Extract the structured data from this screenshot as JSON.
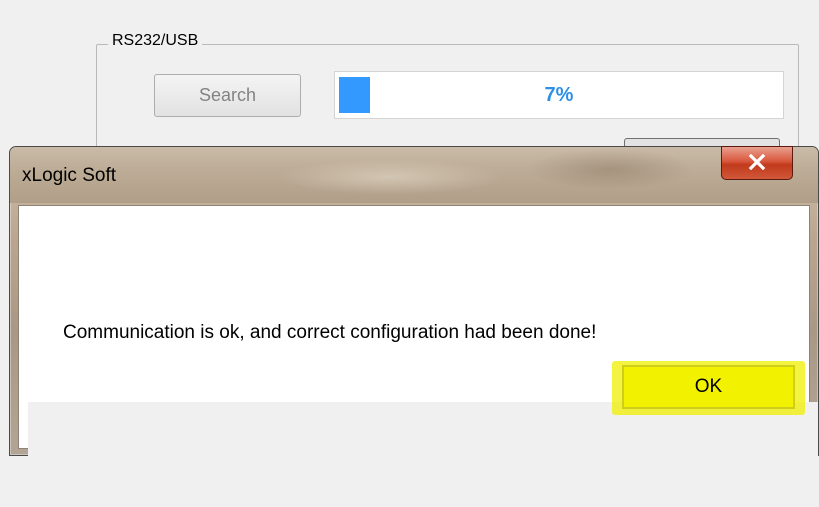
{
  "background_window": {
    "group_label": "RS232/USB",
    "search_label": "Search",
    "progress": {
      "value_percent": 7,
      "text": "7%"
    }
  },
  "dialog": {
    "title": "xLogic Soft",
    "close_icon": "close-x-icon",
    "message": "Communication is ok, and correct configuration had been done!",
    "ok_label": "OK"
  },
  "colors": {
    "progress_fill": "#3399ff",
    "progress_text": "#2f8fe5",
    "close_button": "#c23a1c",
    "ok_highlight": "#f5f500"
  }
}
